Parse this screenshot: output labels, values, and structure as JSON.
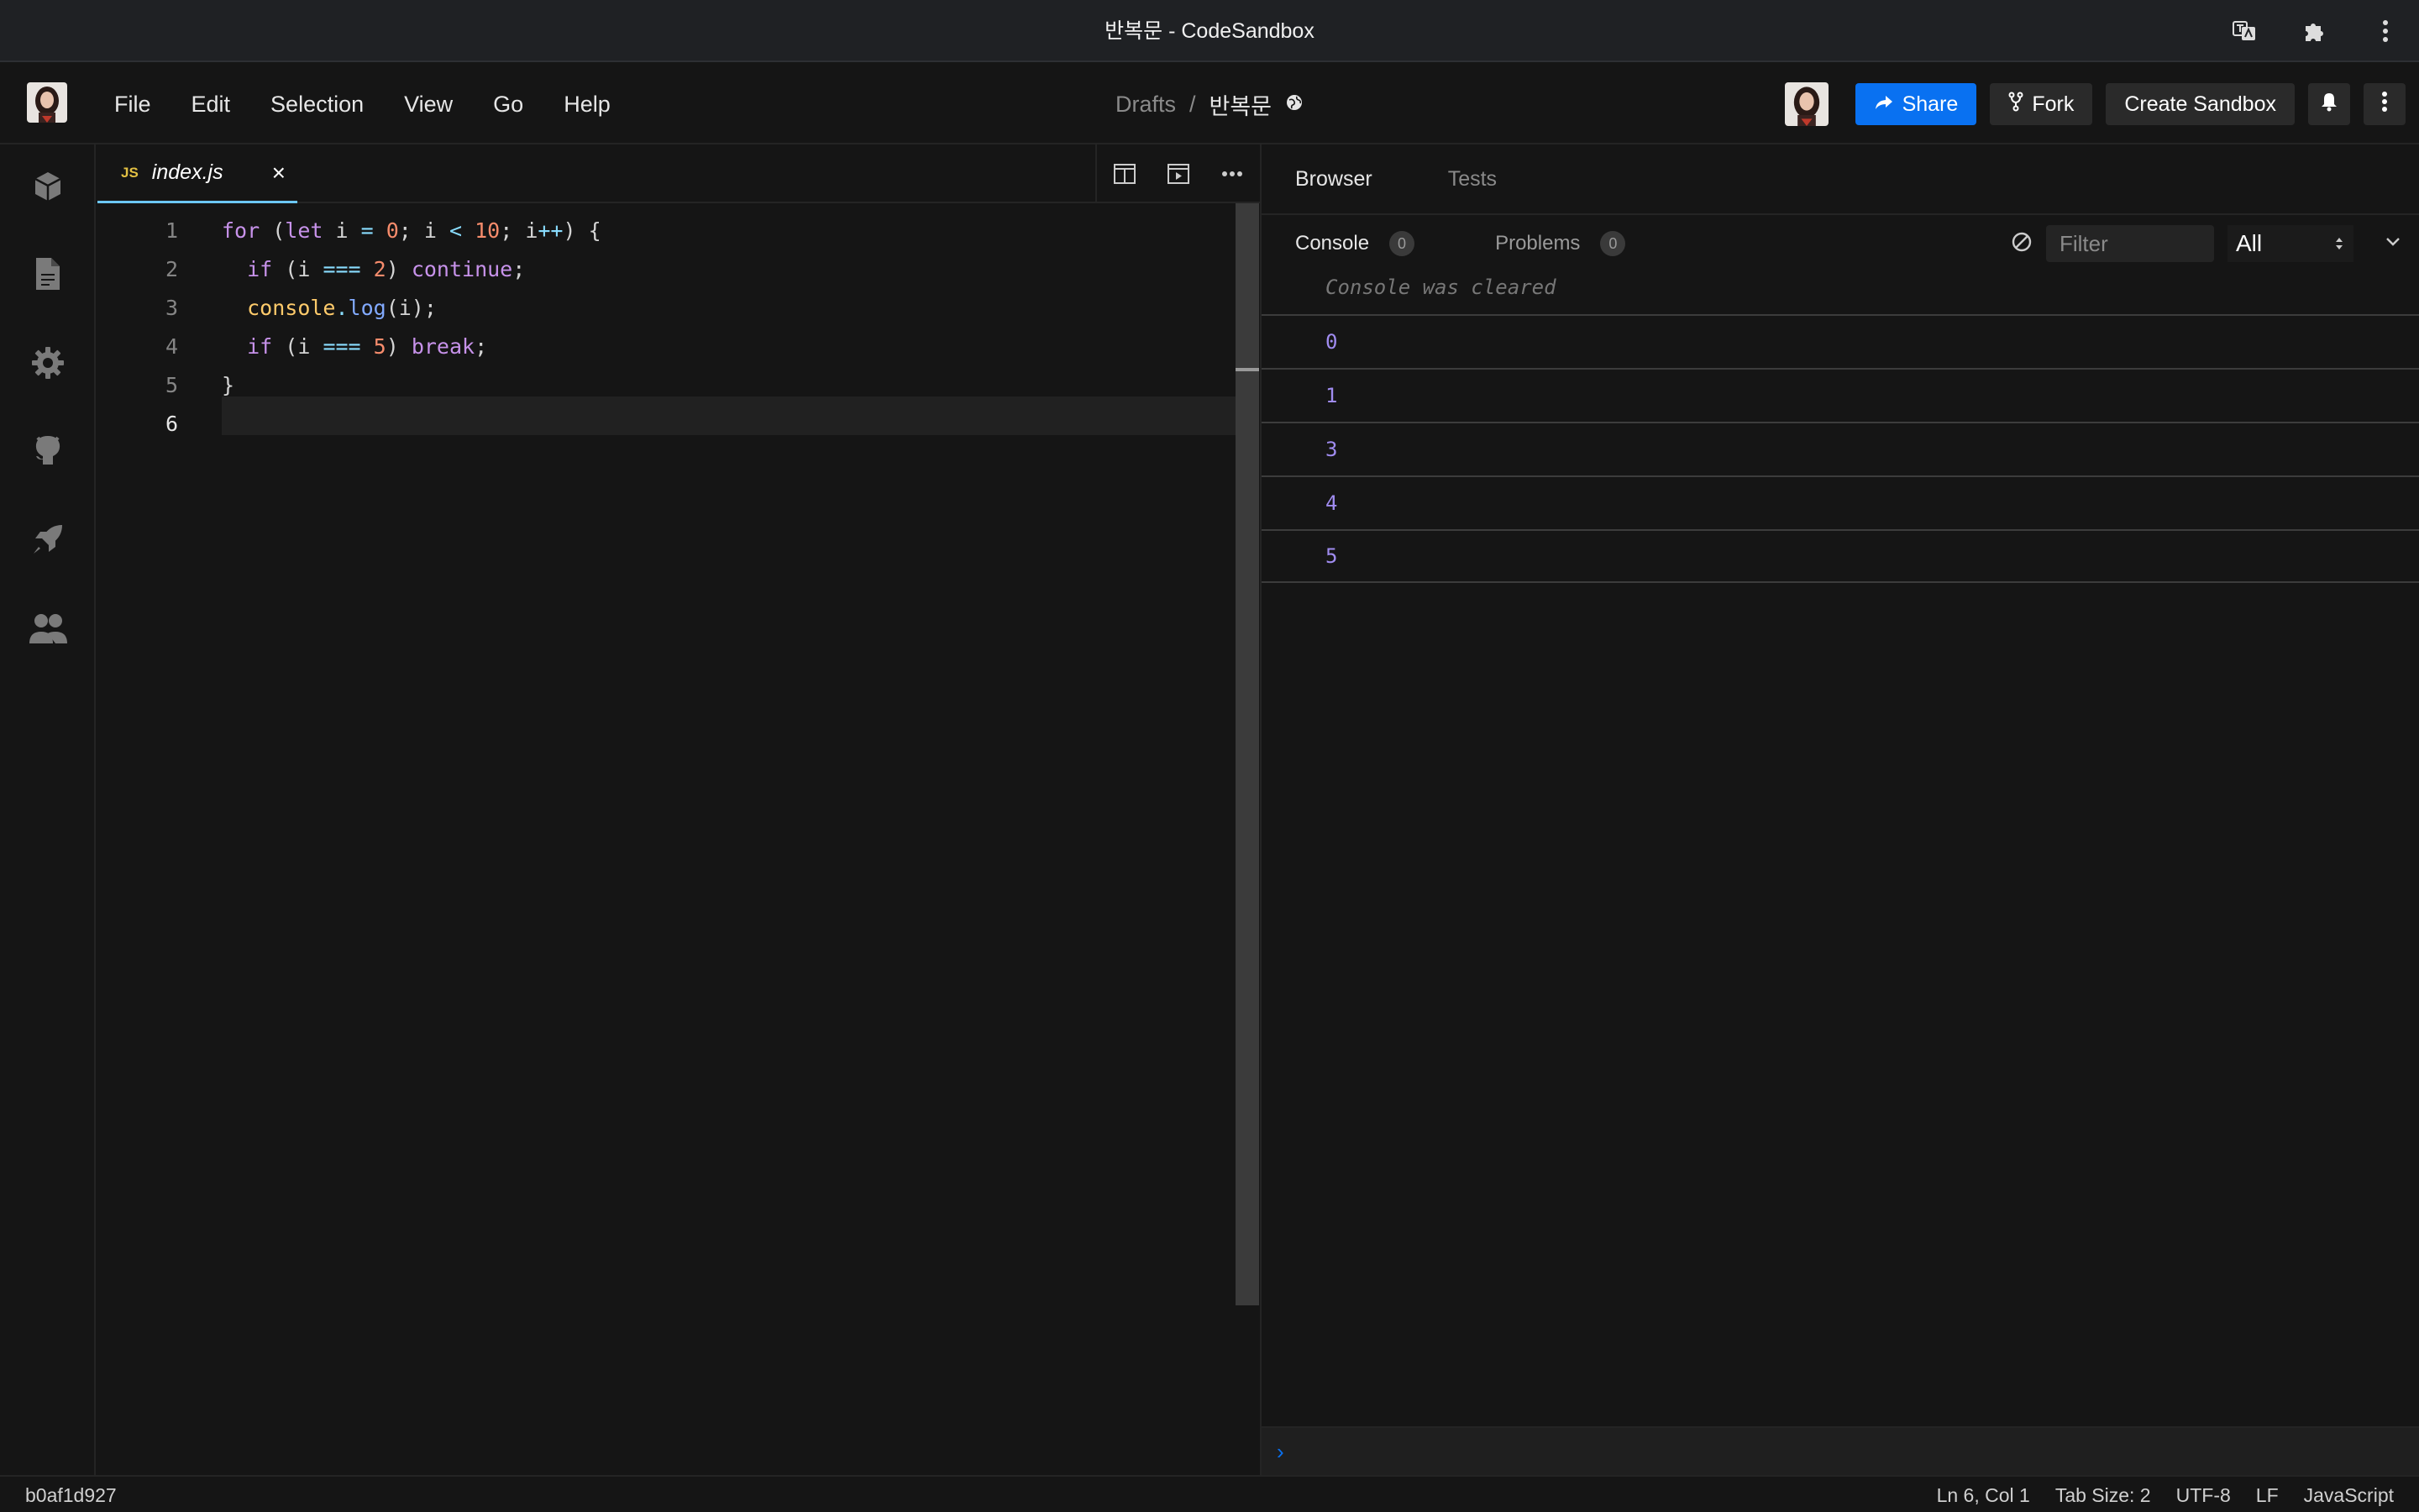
{
  "window": {
    "title": "반복문 - CodeSandbox"
  },
  "menu": [
    "File",
    "Edit",
    "Selection",
    "View",
    "Go",
    "Help"
  ],
  "breadcrumb": {
    "folder": "Drafts",
    "separator": "/",
    "name": "반복문"
  },
  "actions": {
    "share": "Share",
    "fork": "Fork",
    "create": "Create Sandbox"
  },
  "editor": {
    "tab": {
      "badge": "JS",
      "filename": "index.js",
      "close": "×"
    },
    "line_numbers": [
      "1",
      "2",
      "3",
      "4",
      "5",
      "6"
    ],
    "code_lines": [
      "for (let i = 0; i < 10; i++) {",
      "  if (i === 2) continue;",
      "  console.log(i);",
      "  if (i === 5) break;",
      "}",
      ""
    ]
  },
  "panel": {
    "tabs": {
      "browser": "Browser",
      "tests": "Tests"
    },
    "console_tab": {
      "label": "Console",
      "count": "0"
    },
    "problems_tab": {
      "label": "Problems",
      "count": "0"
    },
    "filter_placeholder": "Filter",
    "level_select": "All",
    "cleared_message": "Console was cleared",
    "log_values": [
      "0",
      "1",
      "3",
      "4",
      "5"
    ],
    "prompt": "›"
  },
  "status": {
    "commit": "b0af1d927",
    "position": "Ln 6, Col 1",
    "tab_size": "Tab Size: 2",
    "encoding": "UTF-8",
    "eol": "LF",
    "language": "JavaScript"
  },
  "colors": {
    "accent": "#0971f1",
    "tab_underline": "#6cc7f6",
    "log_value": "#a08cf0"
  }
}
